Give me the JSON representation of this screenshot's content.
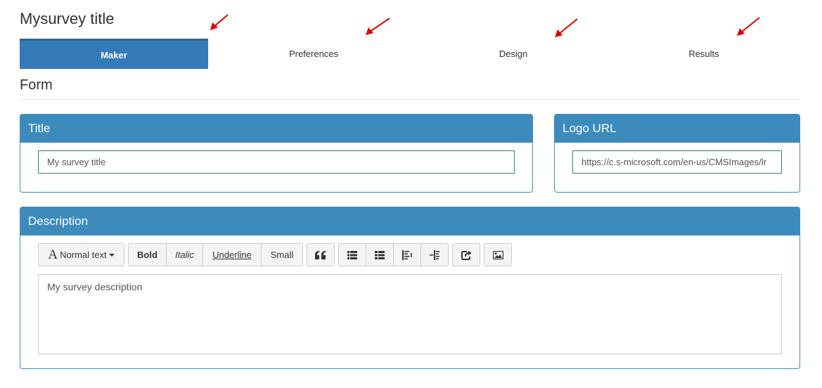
{
  "page": {
    "title": "Mysurvey title"
  },
  "tabs": [
    {
      "label": "Maker",
      "active": true
    },
    {
      "label": "Preferences",
      "active": false
    },
    {
      "label": "Design",
      "active": false
    },
    {
      "label": "Results",
      "active": false
    }
  ],
  "section": {
    "title": "Form"
  },
  "title_panel": {
    "heading": "Title",
    "value": "My survey  title"
  },
  "logo_panel": {
    "heading": "Logo URL",
    "value": "https://c.s-microsoft.com/en-us/CMSImages/lr"
  },
  "description_panel": {
    "heading": "Description",
    "toolbar": {
      "style_label": "Normal text",
      "bold": "Bold",
      "italic": "Italic",
      "underline": "Underline",
      "small": "Small",
      "icons": [
        "quote-icon",
        "unordered-list-icon",
        "ordered-list-icon",
        "outdent-icon",
        "indent-icon",
        "link-icon",
        "image-icon"
      ]
    },
    "value": "My survey description"
  },
  "colors": {
    "accent": "#337ab7",
    "panel": "#3d8bbd",
    "input_border": "#2e8b57",
    "annotation_arrow": "#e00000"
  }
}
